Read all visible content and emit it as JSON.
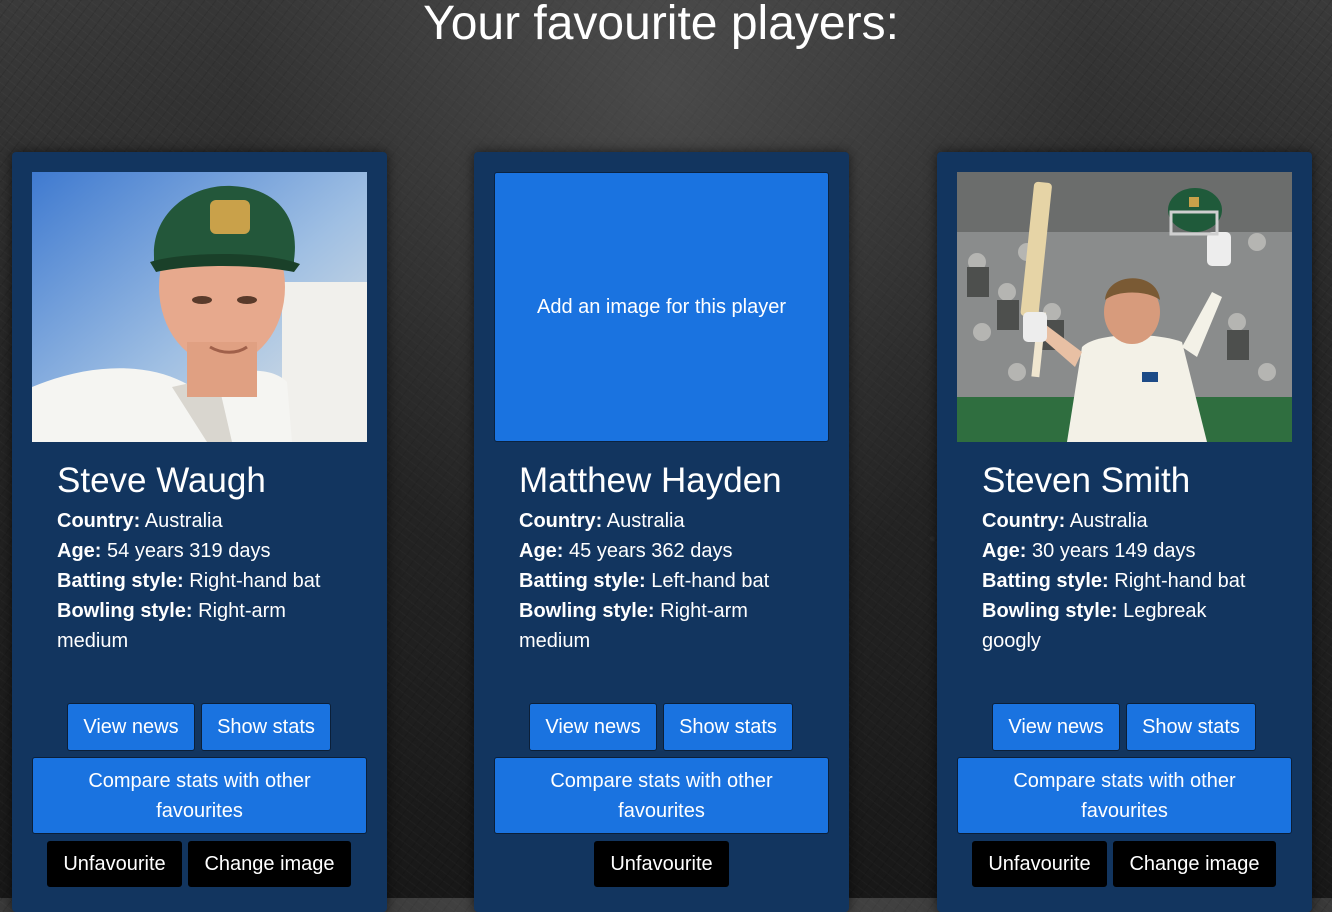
{
  "page_title": "Your favourite players:",
  "labels": {
    "country": "Country:",
    "age": "Age:",
    "batting": "Batting style:",
    "bowling": "Bowling style:"
  },
  "buttons": {
    "view_news": "View news",
    "show_stats": "Show stats",
    "compare": "Compare stats with other favourites",
    "unfavourite": "Unfavourite",
    "change_image": "Change image"
  },
  "players": [
    {
      "name": "Steve Waugh",
      "country": "Australia",
      "age": "54 years 319 days",
      "batting": "Right-hand bat",
      "bowling": "Right-arm medium",
      "has_image": true
    },
    {
      "name": "Matthew Hayden",
      "country": "Australia",
      "age": "45 years 362 days",
      "batting": "Left-hand bat",
      "bowling": "Right-arm medium",
      "has_image": false,
      "add_image_text": "Add an image for this player"
    },
    {
      "name": "Steven Smith",
      "country": "Australia",
      "age": "30 years 149 days",
      "batting": "Right-hand bat",
      "bowling": "Legbreak googly",
      "has_image": true
    }
  ],
  "colors": {
    "card_bg": "#12355f",
    "button_blue": "#1a73e0",
    "button_black": "#000000"
  }
}
